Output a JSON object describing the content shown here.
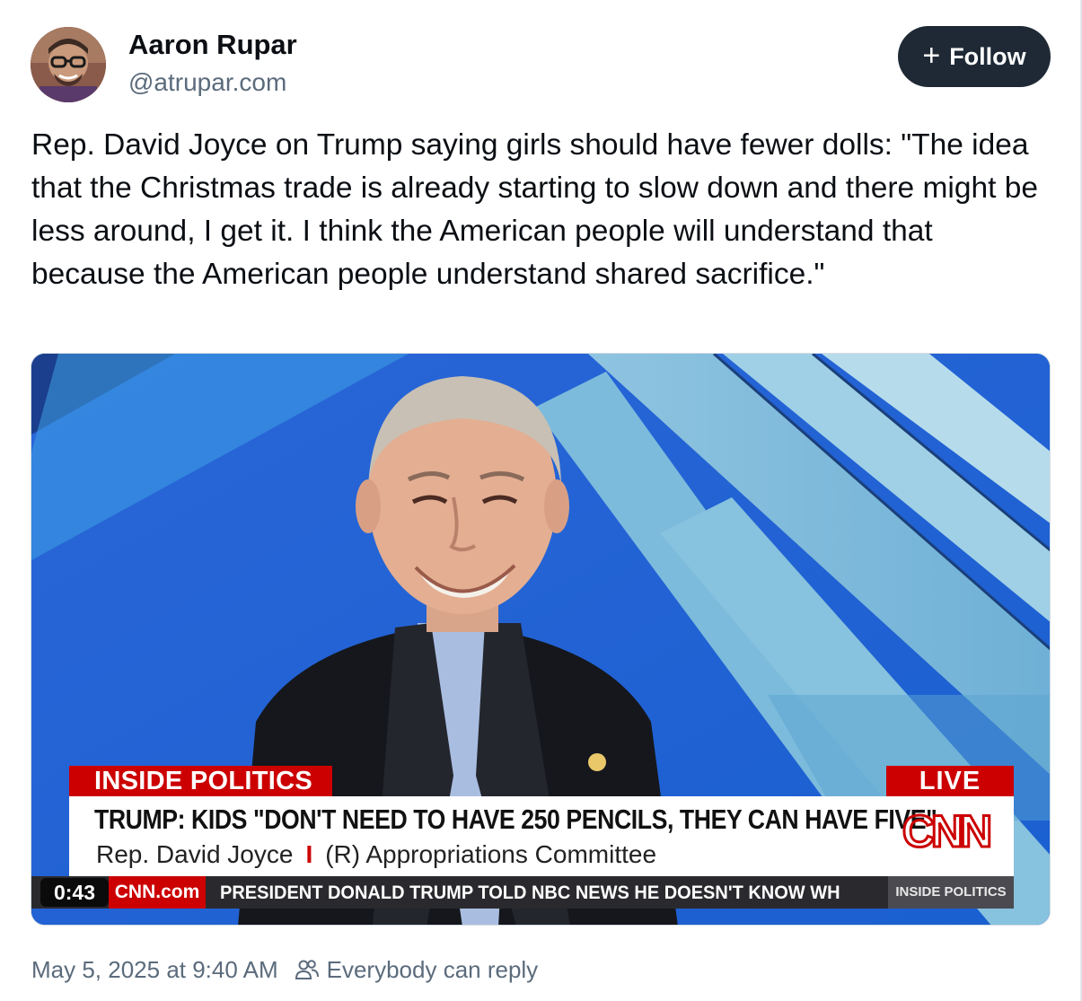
{
  "author": {
    "display_name": "Aaron Rupar",
    "handle": "@atrupar.com"
  },
  "follow_button": {
    "icon": "plus-icon",
    "label": "Follow"
  },
  "post": {
    "text": "Rep. David Joyce on Trump saying girls should have fewer dolls: \"The idea that the Christmas trade is already starting to slow down and there might be less around, I get it. I think the American people will understand that because the American people understand shared sacrifice.\""
  },
  "video": {
    "timer": "0:43",
    "lower_third": {
      "show_name": "INSIDE POLITICS",
      "live_label": "LIVE",
      "headline": "TRUMP: KIDS \"DON'T NEED TO HAVE 250 PENCILS, THEY CAN HAVE FIVE\"",
      "guest_name": "Rep. David Joyce",
      "separator": "I",
      "guest_title": "(R) Appropriations Committee",
      "logo_text": "CNN"
    },
    "ticker": {
      "source": "CNN.com",
      "text": "PRESIDENT DONALD TRUMP TOLD NBC NEWS HE DOESN'T KNOW WH",
      "show_name": "INSIDE POLITICS"
    },
    "colors": {
      "cnn_red": "#cc0000",
      "studio_blue": "#1c6fd6"
    }
  },
  "meta": {
    "timestamp": "May 5, 2025 at 9:40 AM",
    "reply_icon": "people-icon",
    "reply_setting": "Everybody can reply"
  }
}
